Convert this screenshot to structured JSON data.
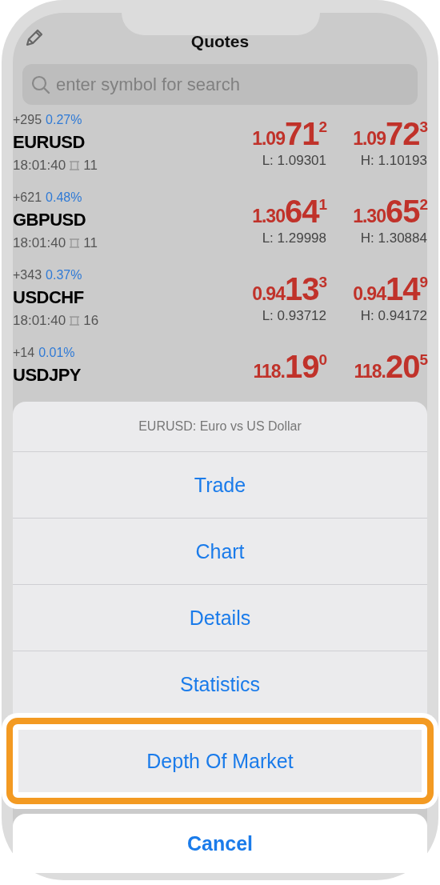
{
  "header": {
    "title": "Quotes"
  },
  "search": {
    "placeholder": "enter symbol for search"
  },
  "quotes": [
    {
      "change": "+295",
      "percent": "0.27%",
      "symbol": "EURUSD",
      "time": "18:01:40",
      "spread": "11",
      "bid": {
        "head": "1.09",
        "big": "71",
        "sup": "2"
      },
      "ask": {
        "head": "1.09",
        "big": "72",
        "sup": "3"
      },
      "low": "L: 1.09301",
      "high": "H: 1.10193"
    },
    {
      "change": "+621",
      "percent": "0.48%",
      "symbol": "GBPUSD",
      "time": "18:01:40",
      "spread": "11",
      "bid": {
        "head": "1.30",
        "big": "64",
        "sup": "1"
      },
      "ask": {
        "head": "1.30",
        "big": "65",
        "sup": "2"
      },
      "low": "L: 1.29998",
      "high": "H: 1.30884"
    },
    {
      "change": "+343",
      "percent": "0.37%",
      "symbol": "USDCHF",
      "time": "18:01:40",
      "spread": "16",
      "bid": {
        "head": "0.94",
        "big": "13",
        "sup": "3"
      },
      "ask": {
        "head": "0.94",
        "big": "14",
        "sup": "9"
      },
      "low": "L: 0.93712",
      "high": "H: 0.94172"
    },
    {
      "change": "+14",
      "percent": "0.01%",
      "symbol": "USDJPY",
      "bid": {
        "head": "118.",
        "big": "19",
        "sup": "0"
      },
      "ask": {
        "head": "118.",
        "big": "20",
        "sup": "5"
      }
    }
  ],
  "action_sheet": {
    "title": "EURUSD: Euro vs US Dollar",
    "actions": [
      {
        "label": "Trade",
        "selected": false
      },
      {
        "label": "Chart",
        "selected": false
      },
      {
        "label": "Details",
        "selected": false
      },
      {
        "label": "Statistics",
        "selected": false
      },
      {
        "label": "Depth Of Market",
        "selected": true
      }
    ],
    "cancel": "Cancel"
  }
}
